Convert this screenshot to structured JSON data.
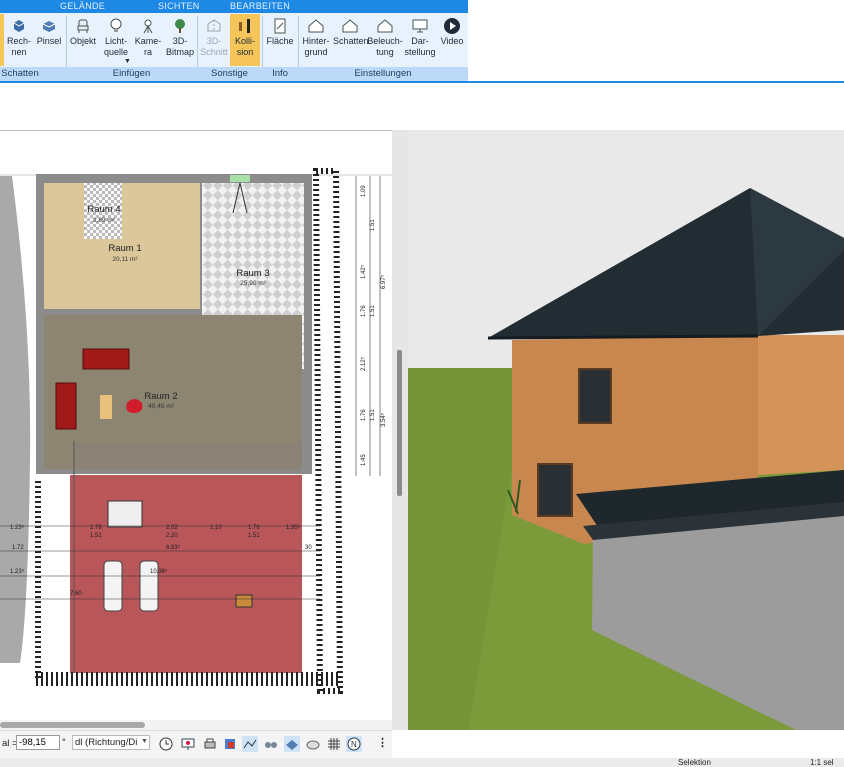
{
  "ribbon": {
    "tabs": [
      "GELÄNDE",
      "SICHTEN",
      "BEARBEITEN"
    ],
    "buttons": {
      "rechnen": "Rech-\nnen",
      "pinsel": "Pinsel",
      "objekt": "Objekt",
      "lichtquelle": "Licht-\nquelle",
      "kamera": "Kame-\nra",
      "bitmap": "3D-\nBitmap",
      "schnitt": "3D-\nSchnitt",
      "kollision": "Kolli-\nsion",
      "flaeche": "Fläche",
      "hintergrund": "Hinter-\ngrund",
      "schatten": "Schatten",
      "beleuchtung": "Beleuch-\ntung",
      "darstellung": "Dar-\nstellung",
      "video": "Video"
    },
    "groups": [
      "Schatten",
      "Einfügen",
      "Sonstige",
      "Info",
      "Einstellungen"
    ]
  },
  "plan": {
    "rooms": [
      {
        "name": "Raum 4",
        "area": "2,89 m²"
      },
      {
        "name": "Raum 1",
        "area": "20,11 m²"
      },
      {
        "name": "Raum 3",
        "area": "25,90 m²"
      },
      {
        "name": "Raum 2",
        "area": "40,45 m²"
      }
    ],
    "dims_right": [
      "1.09",
      "1.51",
      "1.42⁵",
      "1.76",
      "1.51",
      "2.12⁵",
      "1.76",
      "1.51",
      "3.54⁵",
      "1.45",
      "6.97⁵"
    ],
    "dims_h1": [
      "1.23⁵",
      "1.76",
      "1.51",
      "2.02",
      "2.20",
      "1.10",
      "1.76",
      "1.51",
      "1.35⁵"
    ],
    "dims_h2": [
      "1.72",
      "6.83⁵",
      "30"
    ],
    "dims_h3": [
      "1.23⁵",
      "10.36⁵"
    ],
    "dims_h4": [
      "7.60"
    ]
  },
  "toolbar": {
    "angle_prefix": "al =",
    "angle_value": "-98,15",
    "angle_unit": "°",
    "direction": "dl (Richtung/Di"
  },
  "status": {
    "mode": "Selektion",
    "selection": "1:1 sel"
  },
  "colors": {
    "ribbon_blue": "#1e88e5",
    "active_button": "#f6c55a",
    "grass": "#7a9a3a",
    "sky": "#e9e9e9",
    "facade": "#c7874f",
    "roof": "#1f2a30"
  }
}
